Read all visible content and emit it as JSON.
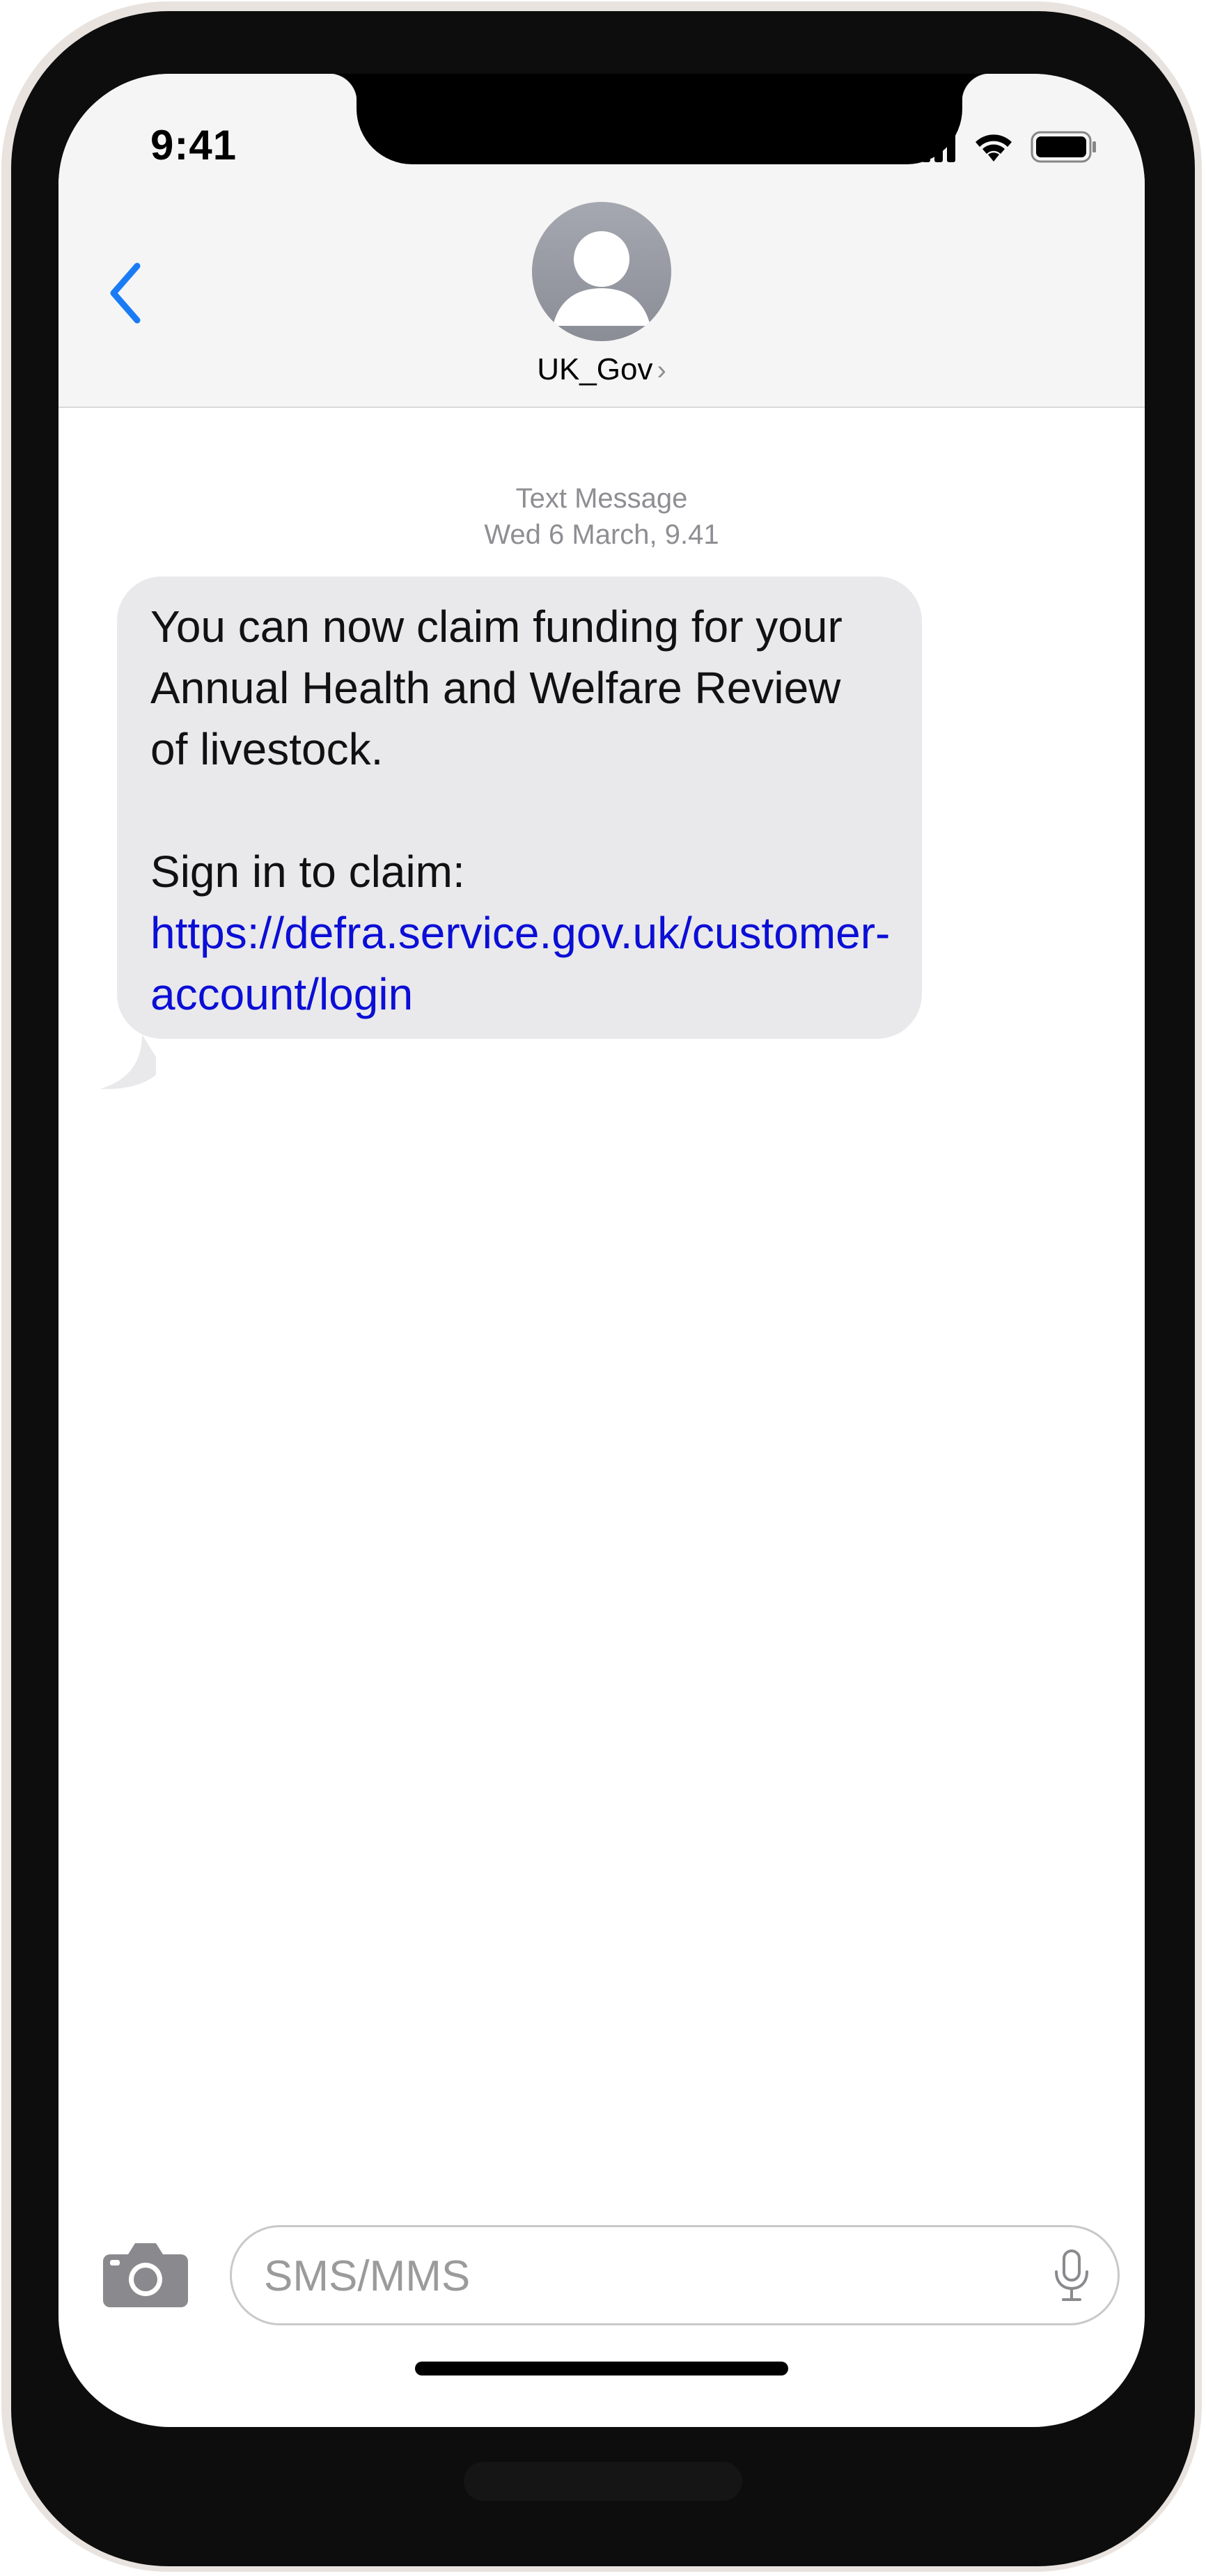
{
  "status_bar": {
    "time": "9:41",
    "signal_icon": "cellular-signal-icon",
    "wifi_icon": "wifi-icon",
    "battery_icon": "battery-icon"
  },
  "header": {
    "back_icon": "chevron-left-icon",
    "avatar_icon": "person-avatar-icon",
    "contact_name": "UK_Gov",
    "contact_chevron": "›"
  },
  "conversation": {
    "meta_label": "Text Message",
    "meta_timestamp": "Wed 6 March, 9.41",
    "message": {
      "line_1": "You can now claim funding for your Annual Health and Welfare Review of livestock.",
      "line_2_prefix": "Sign in to claim: ",
      "link_text": "https://defra.service.gov.uk/customer-account/login"
    }
  },
  "composer": {
    "camera_icon": "camera-icon",
    "input_placeholder": "SMS/MMS",
    "input_value": "",
    "mic_icon": "microphone-icon"
  },
  "colors": {
    "accent_blue": "#1a7cf5",
    "link_blue": "#0b0ed6",
    "bubble_gray": "#e9e9eb",
    "meta_gray": "#8e8e93"
  }
}
